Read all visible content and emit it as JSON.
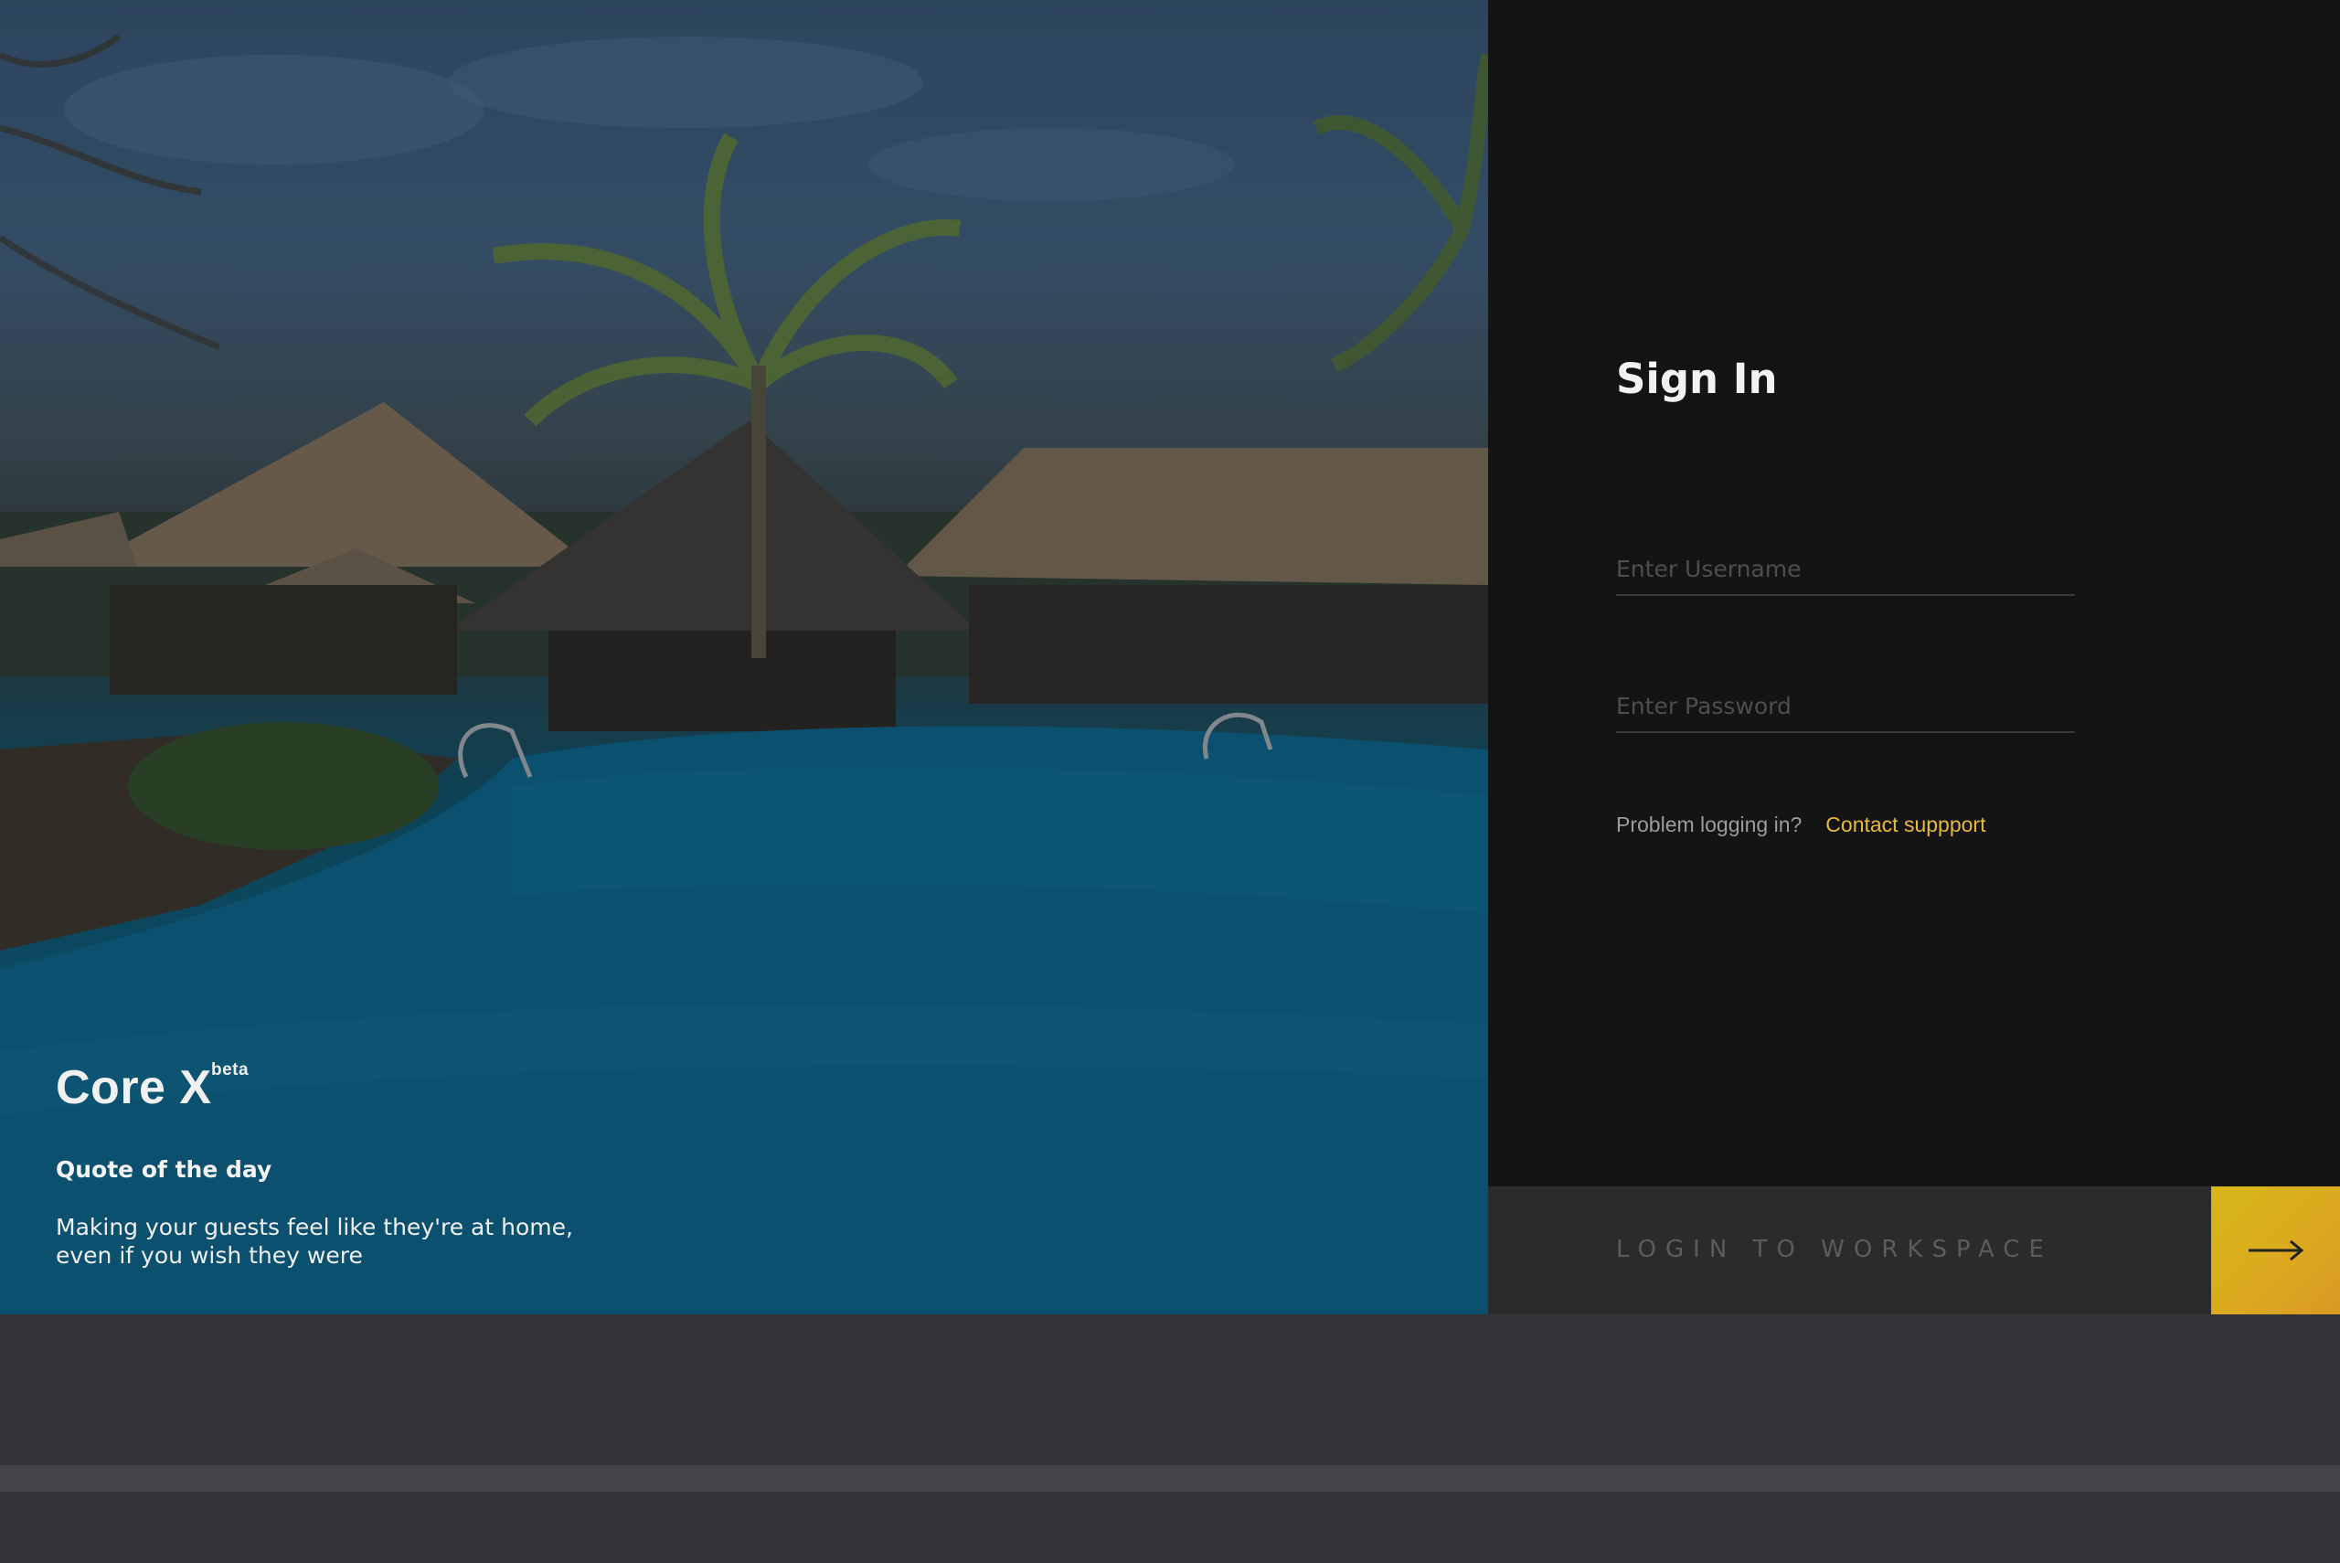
{
  "brand": {
    "name": "Core X",
    "badge": "beta"
  },
  "quote": {
    "title": "Quote of the day",
    "line1": "Making your guests feel like they're at home,",
    "line2": "even if you wish they were"
  },
  "signin": {
    "title": "Sign In",
    "username_placeholder": "Enter Username",
    "password_placeholder": "Enter Password",
    "help_text": "Problem logging in?",
    "support_link": "Contact suppport",
    "login_label": "LOGIN TO WORKSPACE"
  },
  "icons": {
    "submit": "arrow-right-icon"
  },
  "colors": {
    "accent": "#dcae1f",
    "link": "#e8b93c",
    "panel": "#141414",
    "login_bar": "#2b2b2b",
    "page_bg": "#343338"
  }
}
